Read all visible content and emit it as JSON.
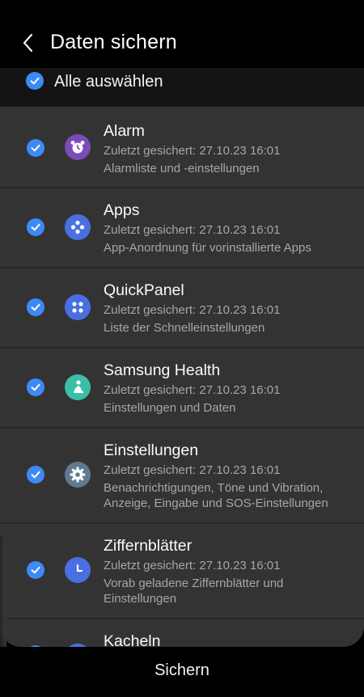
{
  "header": {
    "title": "Daten sichern"
  },
  "select_all": {
    "label": "Alle auswählen",
    "checked": true
  },
  "items": [
    {
      "name": "Alarm",
      "last_backup": "Zuletzt gesichert: 27.10.23 16:01",
      "desc1": "Alarmliste und -einstellungen",
      "desc2": "",
      "icon": "alarm-clock-icon",
      "icon_color": "#7b4bb8",
      "checked": true
    },
    {
      "name": "Apps",
      "last_backup": "Zuletzt gesichert: 27.10.23 16:01",
      "desc1": "App-Anordnung für vorinstallierte Apps",
      "desc2": "",
      "icon": "apps-icon",
      "icon_color": "#4a6fe3",
      "checked": true
    },
    {
      "name": "QuickPanel",
      "last_backup": "Zuletzt gesichert: 27.10.23 16:01",
      "desc1": "Liste der Schnelleinstellungen",
      "desc2": "",
      "icon": "quickpanel-icon",
      "icon_color": "#4a6fe3",
      "checked": true
    },
    {
      "name": "Samsung Health",
      "last_backup": "Zuletzt gesichert: 27.10.23 16:01",
      "desc1": "Einstellungen und Daten",
      "desc2": "",
      "icon": "samsung-health-icon",
      "icon_color": "#3bbfa8",
      "checked": true
    },
    {
      "name": "Einstellungen",
      "last_backup": "Zuletzt gesichert: 27.10.23 16:01",
      "desc1": "Benachrichtigungen, Töne und Vibration,",
      "desc2": "Anzeige, Eingabe und SOS-Einstellungen",
      "icon": "gear-icon",
      "icon_color": "#5f7a93",
      "checked": true
    },
    {
      "name": "Ziffernblätter",
      "last_backup": "Zuletzt gesichert: 27.10.23 16:01",
      "desc1": "Vorab geladene Ziffernblätter und",
      "desc2": "Einstellungen",
      "icon": "watch-face-icon",
      "icon_color": "#4a6fe3",
      "checked": true
    },
    {
      "name": "Kacheln",
      "last_backup": "",
      "desc1": "",
      "desc2": "",
      "icon": "tiles-icon",
      "icon_color": "#4a6fe3",
      "checked": true
    }
  ],
  "footer": {
    "save_label": "Sichern"
  }
}
